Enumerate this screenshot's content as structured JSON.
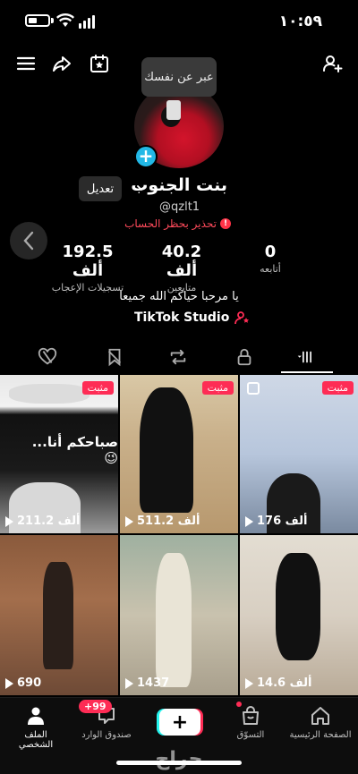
{
  "status_bar": {
    "time": "١٠:٥٩"
  },
  "tooltip": {
    "text": "عبر عن نفسك"
  },
  "profile": {
    "display_name": "بنت الجنوب",
    "username": "@qzlt1",
    "warning": "تحذير بحظر الحساب",
    "edit_label": "تعديل",
    "stats": [
      {
        "value": "192.5 ألف",
        "label": "تسجيلات الإعجاب"
      },
      {
        "value": "40.2 ألف",
        "label": "متابعين"
      },
      {
        "value": "0",
        "label": "أتابعه"
      }
    ],
    "bio": "يا مرحبا حياكم الله جميعا",
    "studio_label": "TikTok Studio"
  },
  "grid": {
    "pinned_label": "مثبت",
    "videos": [
      {
        "views": "211.2 ألف",
        "caption": "صباحكم أنا...😉",
        "pinned": true
      },
      {
        "views": "511.2 ألف",
        "caption": "",
        "pinned": true
      },
      {
        "views": "176 ألف",
        "caption": "",
        "pinned": true
      },
      {
        "views": "690",
        "caption": "",
        "pinned": false
      },
      {
        "views": "1437",
        "caption": "",
        "pinned": false
      },
      {
        "views": "14.6 ألف",
        "caption": "",
        "pinned": false
      }
    ]
  },
  "bottom_nav": {
    "profile": "الملف الشخصي",
    "inbox": "صندوق الوارد",
    "inbox_badge": "+99",
    "shop": "التسوّق",
    "home": "الصفحة الرئيسية"
  },
  "watermark": "حراج",
  "colors": {
    "accent": "#fe2c55",
    "cyan": "#25f4ee",
    "warning": "#ff4a5b"
  }
}
